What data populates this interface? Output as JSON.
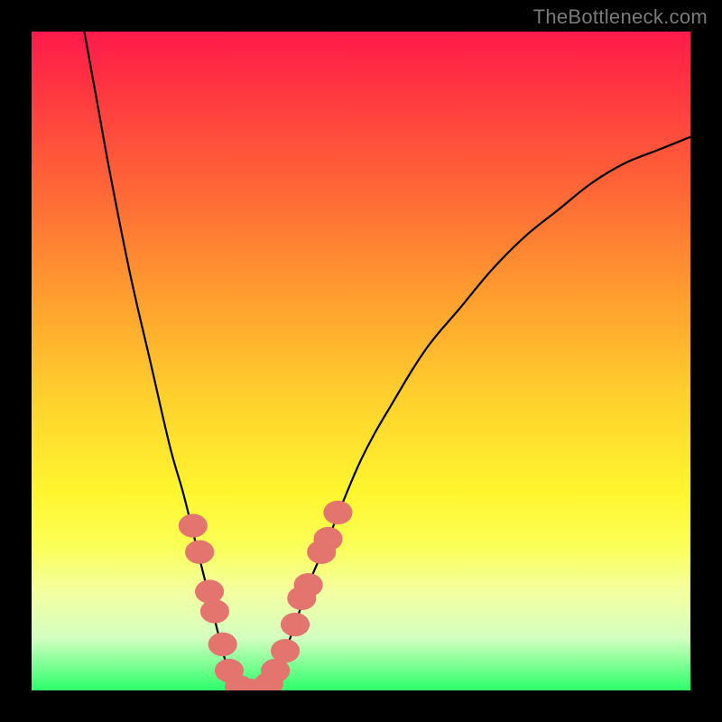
{
  "watermark": "TheBottleneck.com",
  "chart_data": {
    "type": "line",
    "title": "",
    "xlabel": "",
    "ylabel": "",
    "xlim": [
      0,
      100
    ],
    "ylim": [
      0,
      100
    ],
    "grid": false,
    "legend": false,
    "annotations": [],
    "series": [
      {
        "name": "bottleneck-curve",
        "color": "#000000",
        "x": [
          8,
          10,
          12,
          15,
          18,
          21,
          23,
          25,
          27,
          29,
          30,
          32,
          33,
          34,
          35,
          38,
          40,
          42,
          45,
          50,
          55,
          60,
          65,
          70,
          75,
          80,
          85,
          90,
          95,
          100
        ],
        "y": [
          100,
          89,
          78,
          63,
          50,
          37,
          30,
          22,
          14,
          6,
          3,
          0,
          0,
          0,
          0,
          5,
          10,
          16,
          23,
          35,
          44,
          52,
          58,
          64,
          69,
          73,
          77,
          80,
          82,
          84
        ]
      }
    ],
    "markers": {
      "name": "highlighted-points",
      "color": "#e3746e",
      "radius": 2.2,
      "points": [
        {
          "x": 24.5,
          "y": 25
        },
        {
          "x": 25.5,
          "y": 21
        },
        {
          "x": 27.0,
          "y": 15
        },
        {
          "x": 27.8,
          "y": 12
        },
        {
          "x": 29.0,
          "y": 7
        },
        {
          "x": 30.0,
          "y": 3
        },
        {
          "x": 31.5,
          "y": 0.5
        },
        {
          "x": 33.0,
          "y": 0
        },
        {
          "x": 34.5,
          "y": 0
        },
        {
          "x": 36.0,
          "y": 1
        },
        {
          "x": 37.0,
          "y": 3
        },
        {
          "x": 38.5,
          "y": 6
        },
        {
          "x": 40.0,
          "y": 10
        },
        {
          "x": 41.0,
          "y": 14
        },
        {
          "x": 42.0,
          "y": 16
        },
        {
          "x": 44.0,
          "y": 21
        },
        {
          "x": 45.0,
          "y": 23
        },
        {
          "x": 46.5,
          "y": 27
        }
      ]
    },
    "gradient_stops": [
      {
        "pos": 0,
        "color": "#ff1a4b"
      },
      {
        "pos": 25,
        "color": "#ff6a36"
      },
      {
        "pos": 55,
        "color": "#ffcf2d"
      },
      {
        "pos": 78,
        "color": "#fbff56"
      },
      {
        "pos": 100,
        "color": "#2dff6a"
      }
    ]
  }
}
